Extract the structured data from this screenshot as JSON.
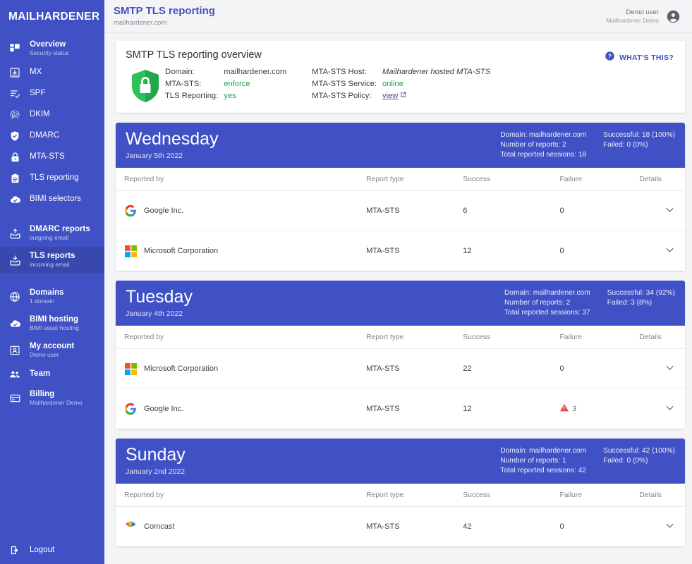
{
  "brand": "MAILHARDENER",
  "sidebar": {
    "items": [
      {
        "label": "Overview",
        "sub": "Security status",
        "icon": "dashboard-icon",
        "bold": true,
        "active": false
      },
      {
        "label": "MX",
        "sub": "",
        "icon": "mx-inbox-icon",
        "bold": false,
        "active": false
      },
      {
        "label": "SPF",
        "sub": "",
        "icon": "spf-list-check-icon",
        "bold": false,
        "active": false
      },
      {
        "label": "DKIM",
        "sub": "",
        "icon": "fingerprint-icon",
        "bold": false,
        "active": false
      },
      {
        "label": "DMARC",
        "sub": "",
        "icon": "shield-check-icon",
        "bold": false,
        "active": false
      },
      {
        "label": "MTA-STS",
        "sub": "",
        "icon": "lock-icon",
        "bold": false,
        "active": false
      },
      {
        "label": "TLS reporting",
        "sub": "",
        "icon": "clipboard-icon",
        "bold": false,
        "active": false
      },
      {
        "label": "BIMI selectors",
        "sub": "",
        "icon": "cloud-check-icon",
        "bold": false,
        "active": false
      },
      {
        "label": "DMARC reports",
        "sub": "outgoing email",
        "icon": "outbox-upload-icon",
        "bold": true,
        "active": false
      },
      {
        "label": "TLS reports",
        "sub": "incoming email",
        "icon": "inbox-download-icon",
        "bold": true,
        "active": true
      },
      {
        "label": "Domains",
        "sub": "1 domain",
        "icon": "globe-icon",
        "bold": true,
        "active": false
      },
      {
        "label": "BIMI hosting",
        "sub": "BIMI asset hosting",
        "icon": "cloud-check-icon",
        "bold": true,
        "active": false
      },
      {
        "label": "My account",
        "sub": "Demo user",
        "icon": "person-card-icon",
        "bold": true,
        "active": false
      },
      {
        "label": "Team",
        "sub": "",
        "icon": "people-icon",
        "bold": true,
        "active": false
      },
      {
        "label": "Billing",
        "sub": "Mailhardener Demo",
        "icon": "credit-card-icon",
        "bold": true,
        "active": false
      }
    ],
    "logout": {
      "label": "Logout",
      "icon": "logout-icon"
    }
  },
  "topbar": {
    "title": "SMTP TLS reporting",
    "subtitle": "mailhardener.com",
    "user_name": "Demo user",
    "user_org": "Mailhardener Demo",
    "avatar_icon": "account-circle-icon"
  },
  "overview": {
    "title": "SMTP TLS reporting overview",
    "shield_icon": "green-shield-lock-icon",
    "whats_this": {
      "label": "WHAT'S THIS?",
      "icon": "help-circle-icon"
    },
    "left_rows": [
      {
        "key": "Domain:",
        "value": "mailhardener.com",
        "style": "plain"
      },
      {
        "key": "MTA-STS:",
        "value": "enforce",
        "style": "green"
      },
      {
        "key": "TLS Reporting:",
        "value": "yes",
        "style": "green"
      }
    ],
    "right_rows": [
      {
        "key": "MTA-STS Host:",
        "value": "Mailhardener hosted MTA-STS",
        "style": "italic"
      },
      {
        "key": "MTA-STS Service:",
        "value": "online",
        "style": "green"
      },
      {
        "key": "MTA-STS Policy:",
        "value": "view",
        "style": "link"
      }
    ]
  },
  "table_headers": [
    "Reported by",
    "Report type",
    "Success",
    "Failure",
    "Details"
  ],
  "days": [
    {
      "name": "Wednesday",
      "date": "January 5th 2022",
      "stats_left": [
        "Domain: mailhardener.com",
        "Number of reports: 2",
        "Total reported sessions: 18"
      ],
      "stats_right": [
        "Successful: 18 (100%)",
        "Failed: 0 (0%)"
      ],
      "rows": [
        {
          "reporter": "Google Inc.",
          "logo": "google-logo-icon",
          "type": "MTA-STS",
          "success": "6",
          "failure": "0",
          "failure_warn": false
        },
        {
          "reporter": "Microsoft Corporation",
          "logo": "microsoft-logo-icon",
          "type": "MTA-STS",
          "success": "12",
          "failure": "0",
          "failure_warn": false
        }
      ]
    },
    {
      "name": "Tuesday",
      "date": "January 4th 2022",
      "stats_left": [
        "Domain: mailhardener.com",
        "Number of reports: 2",
        "Total reported sessions: 37"
      ],
      "stats_right": [
        "Successful: 34 (92%)",
        "Failed: 3 (8%)"
      ],
      "rows": [
        {
          "reporter": "Microsoft Corporation",
          "logo": "microsoft-logo-icon",
          "type": "MTA-STS",
          "success": "22",
          "failure": "0",
          "failure_warn": false
        },
        {
          "reporter": "Google Inc.",
          "logo": "google-logo-icon",
          "type": "MTA-STS",
          "success": "12",
          "failure": "3",
          "failure_warn": true
        }
      ]
    },
    {
      "name": "Sunday",
      "date": "January 2nd 2022",
      "stats_left": [
        "Domain: mailhardener.com",
        "Number of reports: 1",
        "Total reported sessions: 42"
      ],
      "stats_right": [
        "Successful: 42 (100%)",
        "Failed: 0 (0%)"
      ],
      "rows": [
        {
          "reporter": "Comcast",
          "logo": "comcast-peacock-logo-icon",
          "type": "MTA-STS",
          "success": "42",
          "failure": "0",
          "failure_warn": false
        }
      ]
    }
  ],
  "colors": {
    "brand_blue": "#3f51c5",
    "sidebar_active": "#3848ad",
    "green": "#22a447",
    "warning_red": "#f04438",
    "link_purple": "#5b3f9e"
  }
}
